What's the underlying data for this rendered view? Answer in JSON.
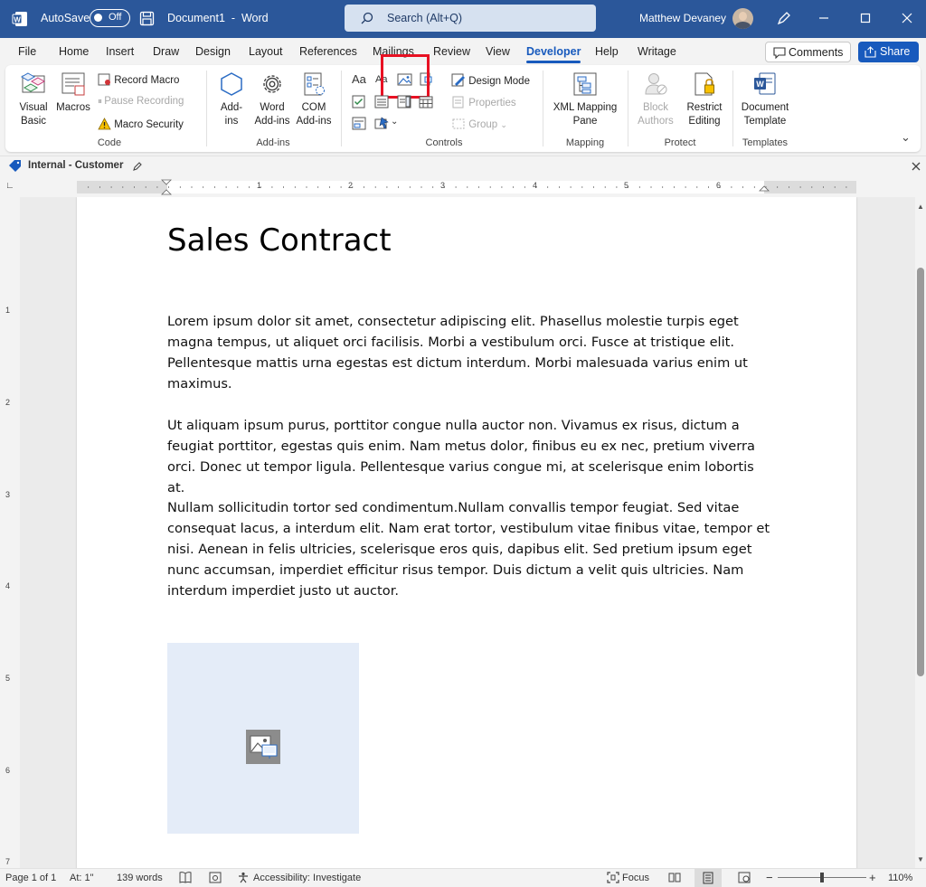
{
  "titlebar": {
    "autosave_label": "AutoSave",
    "autosave_state": "Off",
    "document_title": "Document1  -  Word",
    "search_placeholder": "Search (Alt+Q)",
    "user_name": "Matthew Devaney"
  },
  "tabs": [
    "File",
    "Home",
    "Insert",
    "Draw",
    "Design",
    "Layout",
    "References",
    "Mailings",
    "Review",
    "View",
    "Developer",
    "Help",
    "Writage"
  ],
  "active_tab": "Developer",
  "actions": {
    "comments": "Comments",
    "share": "Share"
  },
  "ribbon": {
    "code": {
      "label": "Code",
      "visual_basic": "Visual\nBasic",
      "macros": "Macros",
      "record_macro": "Record Macro",
      "pause_recording": "Pause Recording",
      "macro_security": "Macro Security"
    },
    "addins": {
      "label": "Add-ins",
      "addins": "Add-\nins",
      "word_addins": "Word\nAdd-ins",
      "com_addins": "COM\nAdd-ins"
    },
    "controls": {
      "label": "Controls",
      "rich_text_glyph": "Aa",
      "plain_text_glyph": "Aa",
      "design_mode": "Design Mode",
      "properties": "Properties",
      "group": "Group"
    },
    "mapping": {
      "label": "Mapping",
      "xml_mapping_pane": "XML Mapping\nPane"
    },
    "protect": {
      "label": "Protect",
      "block_authors": "Block\nAuthors",
      "restrict_editing": "Restrict\nEditing"
    },
    "templates": {
      "label": "Templates",
      "document_template": "Document\nTemplate"
    }
  },
  "sensitivity": {
    "label": "Internal - Customer"
  },
  "ruler_numbers": [
    "1",
    "2",
    "3",
    "4",
    "5",
    "6"
  ],
  "vruler_numbers": [
    "1",
    "2",
    "3",
    "4",
    "5",
    "6",
    "7"
  ],
  "document": {
    "title": "Sales Contract",
    "paragraphs": [
      "Lorem ipsum dolor sit amet, consectetur adipiscing elit. Phasellus molestie turpis eget magna tempus, ut aliquet orci facilisis. Morbi a vestibulum orci. Fusce at tristique elit. Pellentesque mattis urna egestas est dictum interdum. Morbi malesuada varius enim ut maximus.",
      "Ut aliquam ipsum purus, porttitor congue nulla auctor non. Vivamus ex risus, dictum a feugiat porttitor, egestas quis enim. Nam metus dolor, finibus eu ex nec, pretium viverra orci. Donec ut tempor ligula. Pellentesque varius congue mi, at scelerisque enim lobortis at.",
      "Nullam sollicitudin tortor sed condimentum.Nullam convallis tempor feugiat. Sed vitae consequat lacus, a interdum elit. Nam erat tortor, vestibulum vitae finibus vitae, tempor et nisi. Aenean in felis ultricies, scelerisque eros quis, dapibus elit. Sed pretium ipsum eget nunc accumsan, imperdiet efficitur risus tempor. Duis dictum a velit quis ultricies. Nam interdum imperdiet justo ut auctor."
    ]
  },
  "status": {
    "page": "Page 1 of 1",
    "at": "At: 1\"",
    "words": "139 words",
    "accessibility": "Accessibility: Investigate",
    "focus": "Focus",
    "zoom": "110%"
  },
  "colors": {
    "brand": "#2b579a",
    "accent": "#185abd",
    "highlight": "#e81123",
    "picture_placeholder": "#e4ecf8"
  }
}
